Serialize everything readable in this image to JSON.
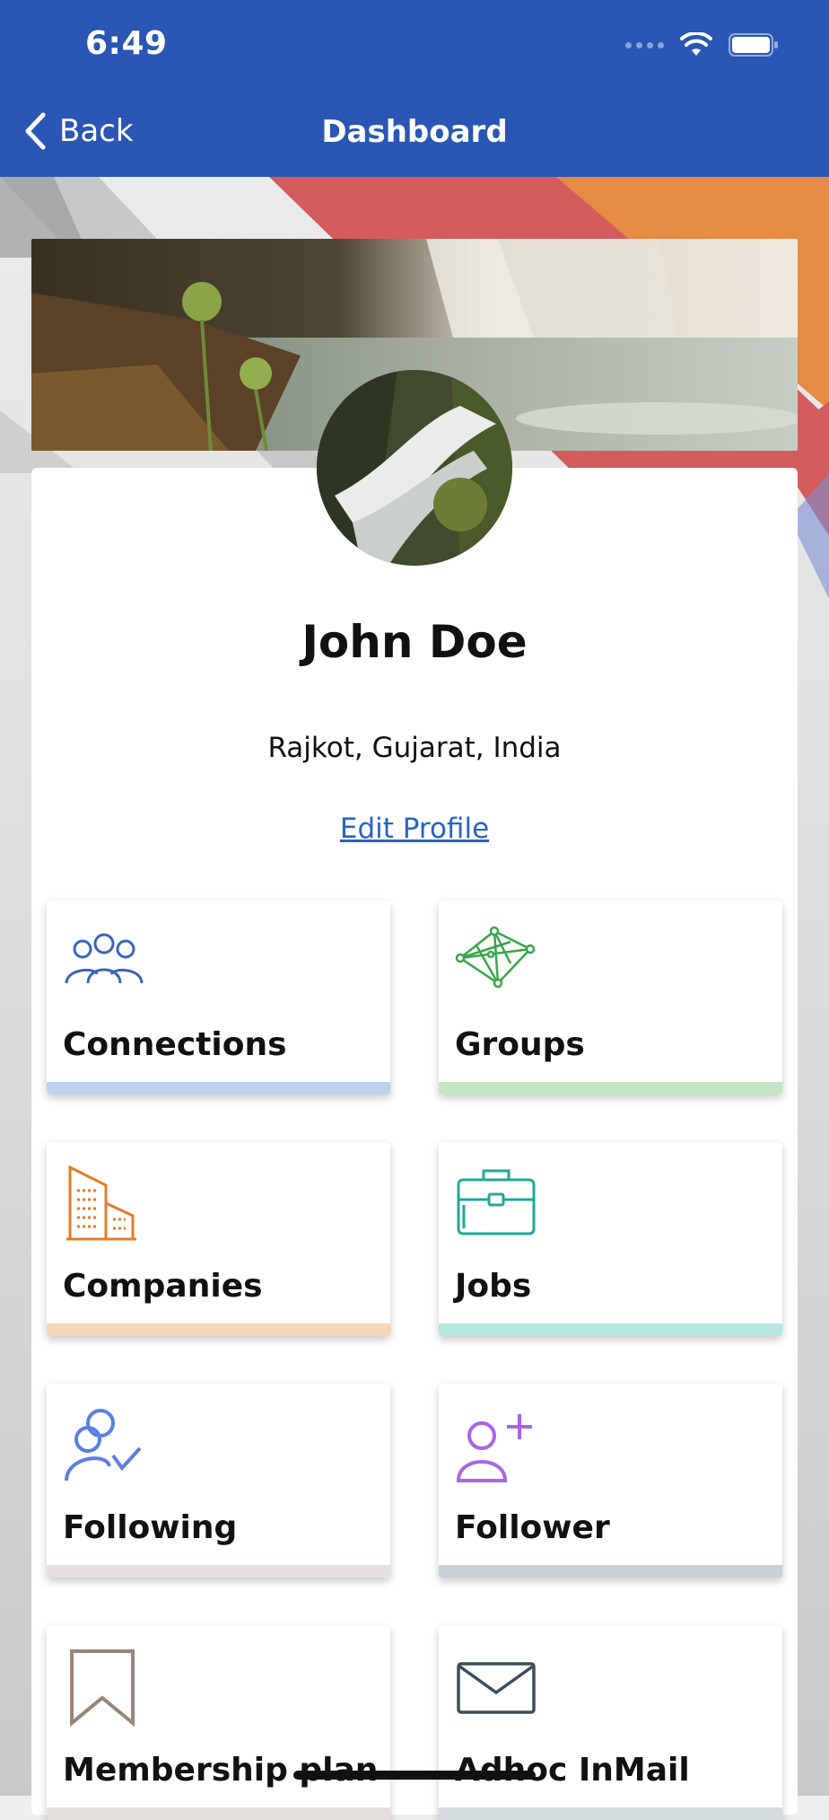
{
  "status_bar": {
    "time": "6:49"
  },
  "nav": {
    "back_label": "Back",
    "title": "Dashboard"
  },
  "profile": {
    "name": "John Doe",
    "location": "Rajkot, Gujarat, India",
    "edit_label": "Edit Profile"
  },
  "tiles": [
    {
      "label": "Connections",
      "icon": "people-group-icon",
      "accent": "#c3d0ec",
      "icon_color": "#3b63c4"
    },
    {
      "label": "Groups",
      "icon": "network-icon",
      "accent": "#c4e6c7",
      "icon_color": "#3aa64a"
    },
    {
      "label": "Companies",
      "icon": "buildings-icon",
      "accent": "#f6d7b7",
      "icon_color": "#e67c27"
    },
    {
      "label": "Jobs",
      "icon": "briefcase-icon",
      "accent": "#b6e6e0",
      "icon_color": "#22a79a"
    },
    {
      "label": "Following",
      "icon": "user-check-icon",
      "accent": "#e4e0dc",
      "icon_color": "#5b7fe3"
    },
    {
      "label": "Follower",
      "icon": "user-add-icon",
      "accent": "#c8d1d4",
      "icon_color": "#a866e6"
    },
    {
      "label": "Membership plan",
      "icon": "bookmark-icon",
      "accent": "#e6e0dc",
      "icon_color": "#9b8478"
    },
    {
      "label": "Adhoc InMail",
      "icon": "mail-icon",
      "accent": "#d6dde0",
      "icon_color": "#3a4e5c"
    }
  ],
  "colors": {
    "appbar": "#2a56b5",
    "link": "#2a63c7"
  }
}
